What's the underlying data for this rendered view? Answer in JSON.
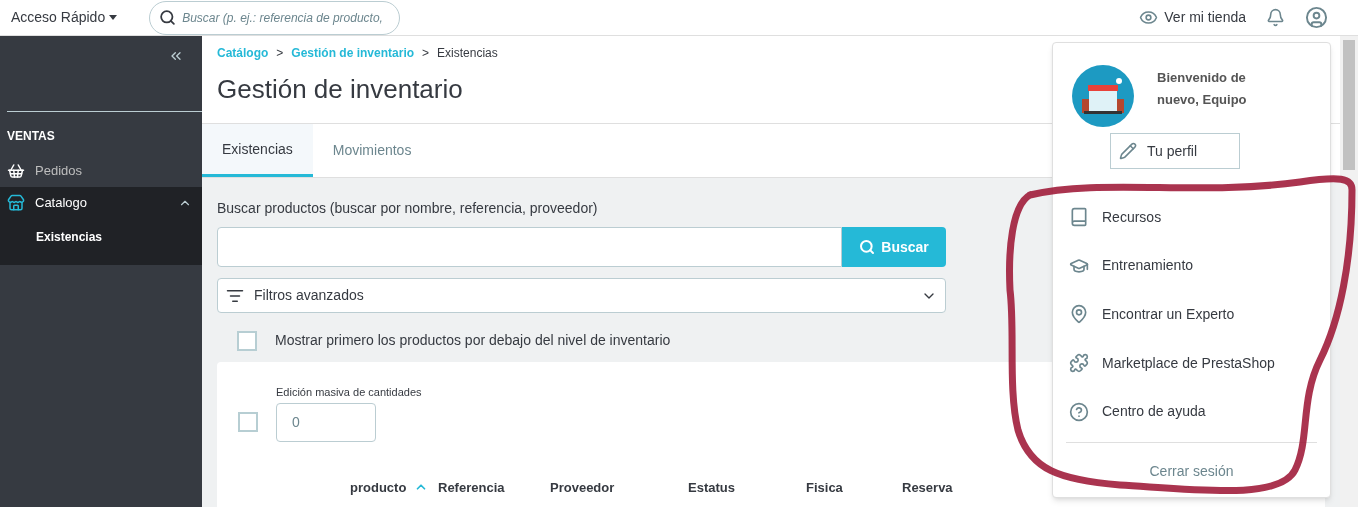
{
  "header": {
    "quick_access": "Acceso Rápido",
    "search_placeholder": "Buscar (p. ej.: referencia de producto,",
    "view_store": "Ver mi tienda"
  },
  "sidebar": {
    "section": "VENTAS",
    "items": [
      {
        "label": "Pedidos",
        "selected": false
      },
      {
        "label": "Catalogo",
        "selected": true,
        "expanded": true,
        "children": [
          {
            "label": "Existencias",
            "selected": true
          }
        ]
      }
    ]
  },
  "breadcrumb": [
    "Catálogo",
    "Gestión de inventario",
    "Existencias"
  ],
  "breadcrumb_separator": ">",
  "title": "Gestión de inventario",
  "tabs": [
    {
      "label": "Existencias",
      "selected": true
    },
    {
      "label": "Movimientos",
      "selected": false
    }
  ],
  "search": {
    "label": "Buscar productos (buscar por nombre, referencia, proveedor)",
    "button": "Buscar",
    "filters": "Filtros avanzados"
  },
  "low_stock": {
    "label": "Mostrar primero los productos por debajo del nivel de inventario",
    "checked": false
  },
  "bulk_edit": {
    "label": "Edición masiva de cantidades",
    "value": "0",
    "checked": false
  },
  "table": {
    "columns": [
      {
        "label": "producto",
        "sorted": true
      },
      {
        "label": "Referencia",
        "sorted": false
      },
      {
        "label": "Proveedor",
        "sorted": false
      },
      {
        "label": "Estatus",
        "sorted": false
      },
      {
        "label": "Fisica",
        "sorted": false
      },
      {
        "label": "Reserva",
        "sorted": false
      }
    ]
  },
  "user_menu": {
    "greeting": "Bienvenido de nuevo, Equipo",
    "profile_button": "Tu perfil",
    "items": [
      "Recursos",
      "Entrenamiento",
      "Encontrar un Experto",
      "Marketplace de PrestaShop",
      "Centro de ayuda"
    ],
    "logout": "Cerrar sesión"
  }
}
